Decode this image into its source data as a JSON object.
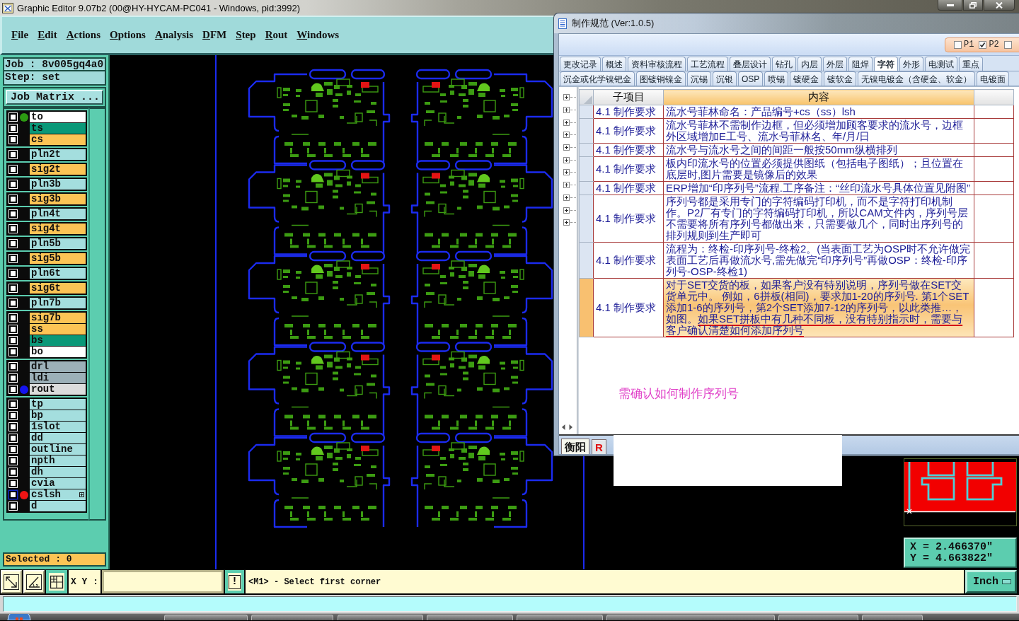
{
  "window": {
    "title": "Graphic Editor 9.07b2 (00@HY-HYCAM-PC041 - Windows, pid:3992)"
  },
  "menu": [
    "File",
    "Edit",
    "Actions",
    "Options",
    "Analysis",
    "DFM",
    "Step",
    "Rout",
    "Windows"
  ],
  "job_panel": {
    "job": "Job : 8v005gq4a0",
    "step": "Step: set",
    "matrix_button": "Job Matrix ...",
    "selected_count": "Selected : 0"
  },
  "layer_groups": [
    {
      "layers": [
        {
          "name": "to",
          "color": "#ffffff",
          "dot": {
            "color": "#2c9a12"
          },
          "checked": false,
          "highlighted": false,
          "expandable": false
        },
        {
          "name": "ts",
          "color": "#0a9878",
          "checked": false,
          "highlighted": false,
          "expandable": false
        },
        {
          "name": "cs",
          "color": "#fcc455",
          "checked": false,
          "highlighted": false,
          "expandable": false
        }
      ]
    },
    {
      "layers": [
        {
          "name": "pln2t",
          "color": "#a4dede",
          "checked": false,
          "highlighted": false,
          "expandable": false
        }
      ]
    },
    {
      "layers": [
        {
          "name": "sig2t",
          "color": "#fcc455",
          "checked": false,
          "highlighted": false,
          "expandable": false
        }
      ]
    },
    {
      "layers": [
        {
          "name": "pln3b",
          "color": "#a4dede",
          "checked": false,
          "highlighted": false,
          "expandable": false
        }
      ]
    },
    {
      "layers": [
        {
          "name": "sig3b",
          "color": "#fcc455",
          "checked": false,
          "highlighted": false,
          "expandable": false
        }
      ]
    },
    {
      "layers": [
        {
          "name": "pln4t",
          "color": "#a4dede",
          "checked": false,
          "highlighted": false,
          "expandable": false
        }
      ]
    },
    {
      "layers": [
        {
          "name": "sig4t",
          "color": "#fcc455",
          "checked": false,
          "highlighted": false,
          "expandable": false
        }
      ]
    },
    {
      "layers": [
        {
          "name": "pln5b",
          "color": "#a4dede",
          "checked": false,
          "highlighted": false,
          "expandable": false
        }
      ]
    },
    {
      "layers": [
        {
          "name": "sig5b",
          "color": "#fcc455",
          "checked": false,
          "highlighted": false,
          "expandable": false
        }
      ]
    },
    {
      "layers": [
        {
          "name": "pln6t",
          "color": "#a4dede",
          "checked": false,
          "highlighted": false,
          "expandable": false
        }
      ]
    },
    {
      "layers": [
        {
          "name": "sig6t",
          "color": "#fcc455",
          "checked": false,
          "highlighted": false,
          "expandable": false
        }
      ]
    },
    {
      "layers": [
        {
          "name": "pln7b",
          "color": "#a4dede",
          "checked": false,
          "highlighted": false,
          "expandable": false
        }
      ]
    },
    {
      "layers": [
        {
          "name": "sig7b",
          "color": "#fcc455",
          "checked": false,
          "highlighted": false,
          "expandable": false
        },
        {
          "name": "ss",
          "color": "#fcc455",
          "checked": false,
          "highlighted": false,
          "expandable": false
        },
        {
          "name": "bs",
          "color": "#0a9878",
          "checked": false,
          "highlighted": false,
          "expandable": false
        },
        {
          "name": "bo",
          "color": "#ffffff",
          "checked": false,
          "highlighted": false,
          "expandable": false
        }
      ]
    },
    {
      "layers": [
        {
          "name": "drl",
          "color": "#9cb0b8",
          "checked": false,
          "highlighted": false,
          "expandable": false
        },
        {
          "name": "ldi",
          "color": "#9cb0b8",
          "checked": false,
          "highlighted": false,
          "expandable": false
        },
        {
          "name": "rout",
          "color": "#dcdcdc",
          "dot": {
            "color": "#1414f0"
          },
          "checked": false,
          "highlighted": false,
          "expandable": false
        }
      ]
    },
    {
      "layers": [
        {
          "name": "tp",
          "color": "#a4dede",
          "checked": false,
          "highlighted": false,
          "expandable": false
        },
        {
          "name": "bp",
          "color": "#a4dede",
          "checked": false,
          "highlighted": false,
          "expandable": false
        },
        {
          "name": "1slot",
          "color": "#a4dede",
          "checked": false,
          "highlighted": false,
          "expandable": false
        },
        {
          "name": "dd",
          "color": "#a4dede",
          "checked": false,
          "highlighted": false,
          "expandable": false
        },
        {
          "name": "outline",
          "color": "#a4dede",
          "checked": false,
          "highlighted": false,
          "expandable": false
        },
        {
          "name": "npth",
          "color": "#a4dede",
          "checked": false,
          "highlighted": false,
          "expandable": false
        },
        {
          "name": "dh",
          "color": "#a4dede",
          "checked": false,
          "highlighted": false,
          "expandable": false
        },
        {
          "name": "cvia",
          "color": "#a4dede",
          "checked": false,
          "highlighted": false,
          "expandable": false
        },
        {
          "name": "cslsh",
          "color": "#a4dede",
          "dot": {
            "color": "#f01414"
          },
          "checked": false,
          "highlighted": true,
          "expandable": true
        },
        {
          "name": "d",
          "color": "#a4dede",
          "checked": false,
          "highlighted": false,
          "expandable": false
        }
      ]
    }
  ],
  "readout": {
    "x": "X = 2.466370\"",
    "y": "Y = 4.663822\""
  },
  "command_bar": {
    "tools": [
      {
        "kind": "arrow",
        "selected": false
      },
      {
        "kind": "angle",
        "selected": false
      },
      {
        "kind": "grid",
        "selected": true
      }
    ],
    "xy_label": "X Y :",
    "alert_button": "!",
    "message": "<M1> - Select first corner",
    "units": "Inch"
  },
  "spec_window": {
    "title": "制作规范 (Ver:1.0.5)",
    "plants": [
      {
        "label": "P1",
        "checked": false
      },
      {
        "label": "P2",
        "checked": true
      },
      {
        "checked": false
      }
    ],
    "tab_rows": [
      {
        "tabs": [
          {
            "label": "更改记录",
            "selected": false
          },
          {
            "label": "概述",
            "selected": false
          },
          {
            "label": "资料审核流程",
            "selected": false
          },
          {
            "label": "工艺流程",
            "selected": false
          },
          {
            "label": "叠层设计",
            "selected": false
          },
          {
            "label": "钻孔",
            "selected": false
          },
          {
            "label": "内层",
            "selected": false
          },
          {
            "label": "外层",
            "selected": false
          },
          {
            "label": "阻焊",
            "selected": false
          },
          {
            "label": "字符",
            "selected": true
          },
          {
            "label": "外形",
            "selected": false
          },
          {
            "label": "电测试",
            "selected": false
          },
          {
            "label": "重点",
            "selected": false
          }
        ]
      },
      {
        "tabs": [
          {
            "label": "沉金或化学镍钯金",
            "selected": false
          },
          {
            "label": "图镀铜镍金",
            "selected": false
          },
          {
            "label": "沉锡",
            "selected": false
          },
          {
            "label": "沉银",
            "selected": false
          },
          {
            "label": "OSP",
            "selected": false
          },
          {
            "label": "喷锡",
            "selected": false
          },
          {
            "label": "镀硬金",
            "selected": false
          },
          {
            "label": "镀软金",
            "selected": false
          },
          {
            "label": "无镍电镀金（含硬金、软金）",
            "selected": false
          },
          {
            "label": "电镀面",
            "selected": false
          }
        ]
      }
    ],
    "tree_nodes": [
      {
        "expanded": false
      },
      {
        "expanded": false
      },
      {
        "expanded": false
      },
      {
        "expanded": false
      },
      {
        "expanded": false
      },
      {
        "expanded": false
      },
      {
        "expanded": false
      },
      {
        "expanded": false
      },
      {
        "expanded": false
      },
      {
        "expanded": false
      },
      {
        "expanded": false
      }
    ],
    "table": {
      "columns": [
        "子项目",
        "内容"
      ],
      "rows": [
        {
          "item": "4.1 制作要求",
          "content": "流水号菲林命名：产品编号+cs（ss）lsh",
          "selected": false
        },
        {
          "item": "4.1 制作要求",
          "content": "流水号菲林不需制作边框，但必须增加顾客要求的流水号，边框外区域增加E工号、流水号菲林名、年/月/日",
          "selected": false
        },
        {
          "item": "4.1 制作要求",
          "content": "流水号与流水号之间的间距一般按50mm纵横排列",
          "selected": false
        },
        {
          "item": "4.1 制作要求",
          "content": "板内印流水号的位置必须提供图纸（包括电子图纸）；且位置在底层时,图片需要是镜像后的效果",
          "selected": false
        },
        {
          "item": "4.1 制作要求",
          "content": "ERP增加“印序列号”流程.工序备注：“丝印流水号具体位置见附图”",
          "selected": false
        },
        {
          "item": "4.1 制作要求",
          "content": "序列号都是采用专门的字符编码打印机，而不是字符打印机制作。P2厂有专门的字符编码打印机，所以CAM文件内，序列号层不需要将所有序列号都做出来，只需要做几个，同时出序列号的排列规则到生产即可",
          "selected": false
        },
        {
          "item": "4.1 制作要求",
          "content": "流程为：终检-印序列号-终检2。(当表面工艺为OSP时不允许做完表面工艺后再做流水号,需先做完“印序列号”再做OSP：终检-印序列号-OSP-终检1)",
          "selected": false
        },
        {
          "item": "4.1 制作要求",
          "content": [
            {
              "text": "对于SET交货的板，如果客户没有特别说明，序列号做在SET交货单元中。 例如，6拼板(相同)，要求加1-20的序列号. 第1个SET添加1-6的序列号，第2个SET添加7-12的序列号，以此类推…，如图。",
              "marked": false
            },
            {
              "text": "如果SET拼板中有几种不同板，没有特别指示时，需要与客户确认清楚如何添加序列号",
              "marked": true
            }
          ],
          "selected": true
        }
      ]
    },
    "note": "需确认如何制作序列号",
    "sheet_tabs": [
      {
        "label": "衡阳",
        "selected": true,
        "color": "#111111"
      },
      {
        "label": "R",
        "selected": false,
        "color": "#e01010"
      }
    ]
  }
}
